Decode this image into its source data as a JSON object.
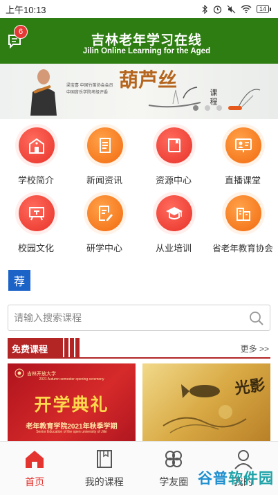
{
  "status_bar": {
    "time": "上午10:13",
    "battery": "14",
    "icons": [
      "bluetooth-icon",
      "alarm-icon",
      "mute-icon",
      "wifi-icon",
      "battery-icon"
    ]
  },
  "header": {
    "title": "吉林老年学习在线",
    "subtitle": "Jilin Online Learning for the Aged",
    "message_badge": "6",
    "color": "#2e7d12"
  },
  "banner": {
    "caption_line1": "梁宝喜  中国竹笛协会会员",
    "caption_line2": "中国音乐学院考级评委",
    "calligraphy": "葫芦丝",
    "brand_text": "课程",
    "slide_count": 4,
    "active_slide": 1
  },
  "categories": [
    {
      "label": "学校简介",
      "icon": "school-building-icon",
      "color": "red"
    },
    {
      "label": "新闻资讯",
      "icon": "news-document-icon",
      "color": "orange"
    },
    {
      "label": "资源中心",
      "icon": "book-icon",
      "color": "red"
    },
    {
      "label": "直播课堂",
      "icon": "live-classroom-icon",
      "color": "orange"
    },
    {
      "label": "校园文化",
      "icon": "campus-board-icon",
      "color": "red"
    },
    {
      "label": "研学中心",
      "icon": "study-edit-icon",
      "color": "orange"
    },
    {
      "label": "从业培训",
      "icon": "graduation-cap-icon",
      "color": "red"
    },
    {
      "label": "省老年教育协会",
      "icon": "association-building-icon",
      "color": "orange"
    }
  ],
  "recommend_tag": "荐",
  "search": {
    "placeholder": "请输入搜索课程"
  },
  "free_courses": {
    "title": "免费课程",
    "more": "更多 >>",
    "courses": [
      {
        "school": "吉林开放大学",
        "headline": "开学典礼",
        "english_top": "2021 Autumn semester opening ceremony",
        "subtitle": "老年教育学院2021年秋季学期",
        "english_bottom": "Senior Education of the open university of Jilin"
      },
      {
        "headline": "光影"
      }
    ]
  },
  "bottom_nav": [
    {
      "label": "首页",
      "icon": "home-icon",
      "active": true
    },
    {
      "label": "我的课程",
      "icon": "my-courses-icon",
      "active": false
    },
    {
      "label": "学友圈",
      "icon": "friends-circle-icon",
      "active": false
    },
    {
      "label": "我的",
      "icon": "profile-icon",
      "active": false
    }
  ],
  "watermark": {
    "part1": "谷普",
    "part2": "软件园"
  }
}
